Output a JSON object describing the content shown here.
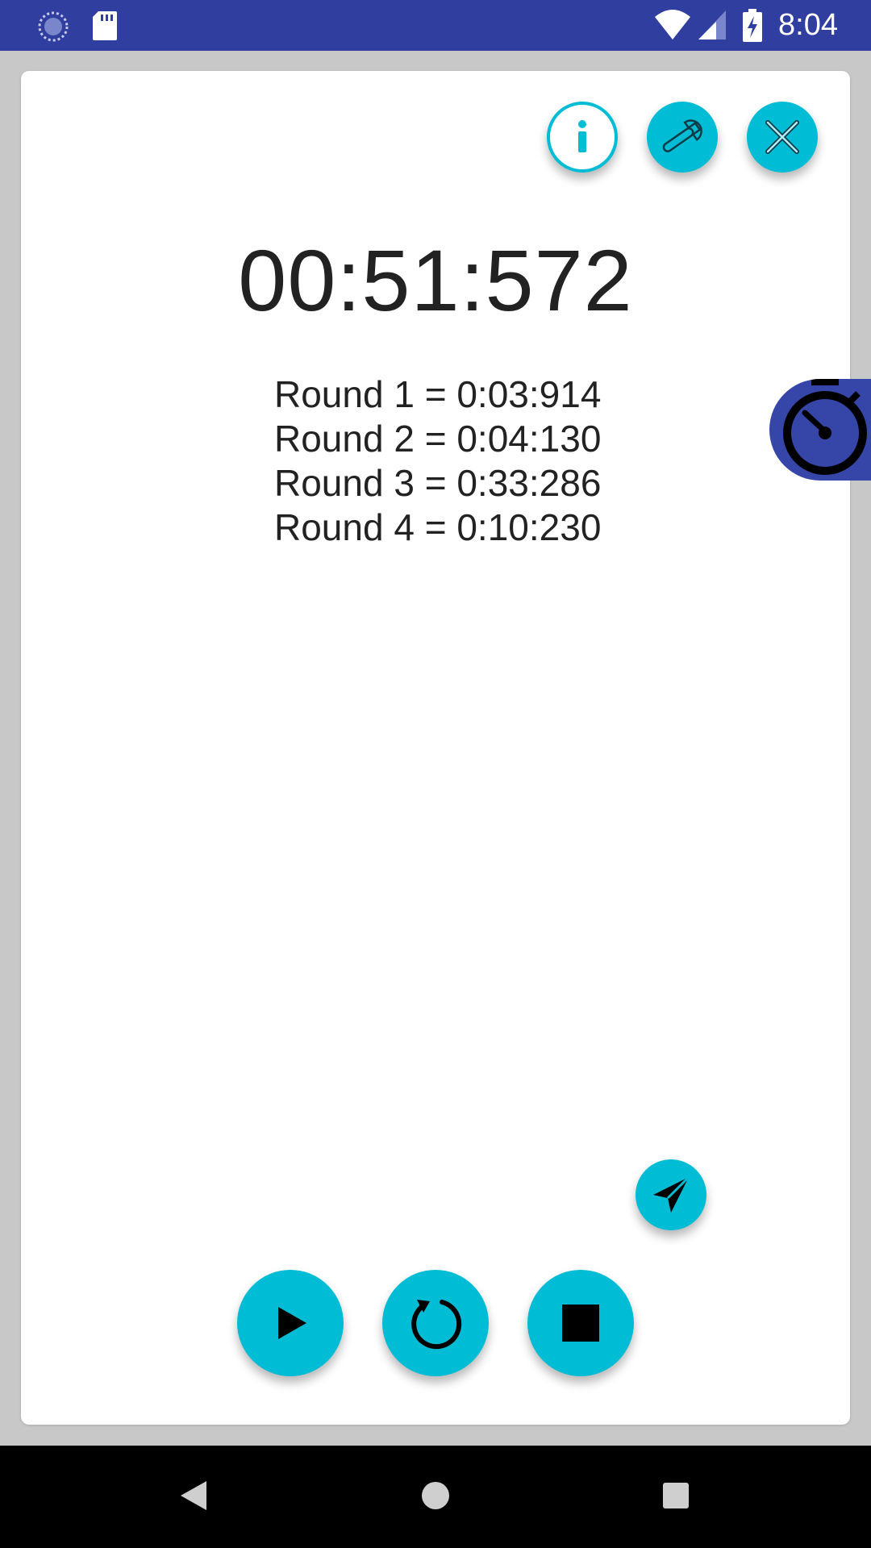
{
  "status_bar": {
    "time": "8:04",
    "icons": [
      "sync-icon",
      "sd-card-icon",
      "wifi-icon",
      "signal-icon",
      "battery-charging-icon"
    ]
  },
  "colors": {
    "status_bar": "#303f9f",
    "accent": "#00bcd4",
    "floating_button": "#3545a8",
    "text": "#222222",
    "background": "#c8c8c8",
    "card": "#ffffff",
    "nav_bar": "#000000"
  },
  "toolbar": {
    "info_icon": "info-icon",
    "settings_icon": "wrench-icon",
    "close_icon": "close-icon"
  },
  "stopwatch": {
    "elapsed": "00:51:572",
    "laps": [
      "Round 1 = 0:03:914",
      "Round 2 = 0:04:130",
      "Round 3 = 0:33:286",
      "Round 4 = 0:10:230"
    ]
  },
  "controls": {
    "share_icon": "send-icon",
    "play_icon": "play-icon",
    "reset_icon": "reset-icon",
    "stop_icon": "stop-icon"
  },
  "floating": {
    "icon": "stopwatch-icon"
  },
  "navigation": {
    "back_icon": "back-icon",
    "home_icon": "home-icon",
    "recents_icon": "recents-icon"
  }
}
